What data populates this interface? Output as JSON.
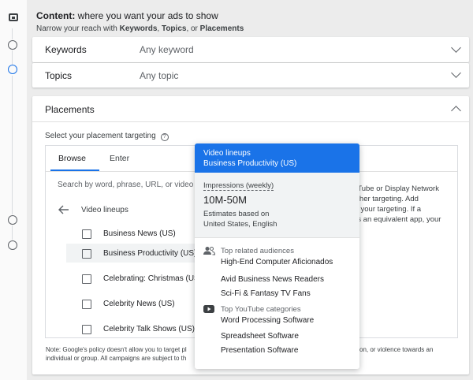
{
  "header": {
    "title_bold": "Content:",
    "title_rest": " where you want your ads to show",
    "sub_prefix": "Narrow your reach with ",
    "sub_kw": "Keywords",
    "sub_sep1": ", ",
    "sub_topics": "Topics",
    "sub_sep2": ", or ",
    "sub_placements": "Placements"
  },
  "keywords": {
    "label": "Keywords",
    "value": "Any keyword"
  },
  "topics": {
    "label": "Topics",
    "value": "Any topic"
  },
  "placements": {
    "label": "Placements",
    "select_label": "Select your placement targeting",
    "help_glyph": "?",
    "tabs": [
      "Browse",
      "Enter"
    ],
    "search_placeholder": "Search by word, phrase, URL, or video ID",
    "back_label": "Video lineups",
    "items": [
      "Business News (US)",
      "Business Productivity (US)",
      "Celebrating: Christmas (US)",
      "Celebrity News (US)",
      "Celebrity Talk Shows (US)"
    ],
    "right_text": [
      "uTube or Display Network",
      "other targeting. Add",
      "w your targeting. If a",
      "as an equivalent app, your"
    ],
    "note_line1_a": "Note: Google's policy doesn't allow you to target pl",
    "note_line1_b": "on, or violence towards an",
    "note_line2_a": "individual or group. All campaigns are subject to th"
  },
  "popup": {
    "title": "Video lineups",
    "subtitle": "Business Productivity (US)",
    "impressions_label": "Impressions (weekly)",
    "impressions_value": "10M-50M",
    "estimates_label": "Estimates based on",
    "estimates_loc": "United States, English",
    "audiences_heading": "Top related audiences",
    "audiences": [
      "High-End Computer Aficionados",
      "Avid Business News Readers",
      "Sci-Fi & Fantasy TV Fans"
    ],
    "categories_heading": "Top YouTube categories",
    "categories": [
      "Word Processing Software",
      "Spreadsheet Software",
      "Presentation Software"
    ]
  },
  "colors": {
    "accent": "#1a73e8",
    "bg": "#ececec"
  }
}
